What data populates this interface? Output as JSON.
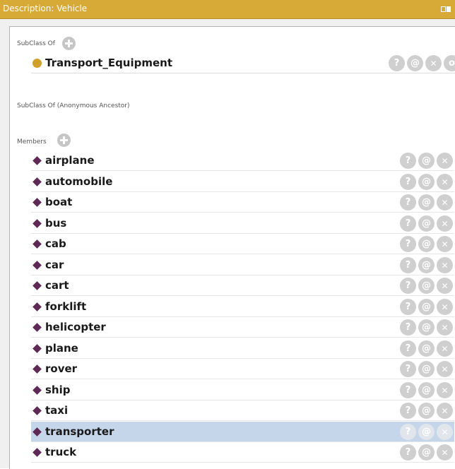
{
  "window": {
    "title": "Description: Vehicle"
  },
  "sections": {
    "subclass_of": {
      "label": "SubClass Of",
      "items": [
        {
          "name": "Transport_Equipment"
        }
      ]
    },
    "anonymous_ancestor": {
      "label": "SubClass Of (Anonymous Ancestor)"
    },
    "members": {
      "label": "Members",
      "items": [
        {
          "name": "airplane"
        },
        {
          "name": "automobile"
        },
        {
          "name": "boat"
        },
        {
          "name": "bus"
        },
        {
          "name": "cab"
        },
        {
          "name": "car"
        },
        {
          "name": "cart"
        },
        {
          "name": "forklift"
        },
        {
          "name": "helicopter"
        },
        {
          "name": "plane"
        },
        {
          "name": "rover"
        },
        {
          "name": "ship"
        },
        {
          "name": "taxi"
        },
        {
          "name": "transporter",
          "selected": true
        },
        {
          "name": "truck"
        }
      ]
    }
  },
  "row_actions": {
    "help": "?",
    "annotate": "@"
  },
  "colors": {
    "titlebar": "#d7a936",
    "class_bullet": "#d1a02c",
    "individual_bullet": "#5e2a55",
    "selected_row": "#c5d6ea"
  },
  "icons": {
    "class_bullet": "class-circle-icon",
    "individual_bullet": "individual-diamond-icon",
    "add": "plus-icon",
    "help": "help-icon",
    "annotate": "at-sign-icon",
    "delete": "close-icon"
  }
}
